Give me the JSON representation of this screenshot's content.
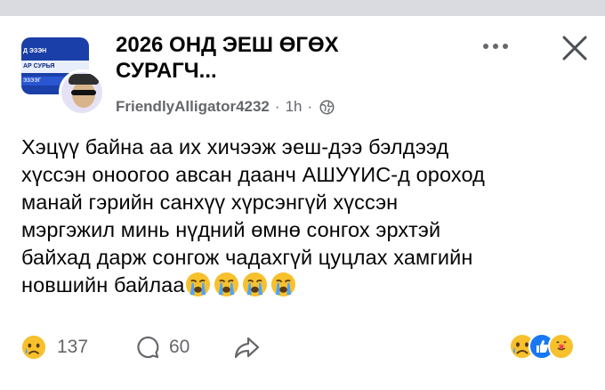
{
  "post": {
    "group_thumb_lines": [
      "Д ЭЗЭН",
      "АР СУРЬЯ",
      "ЭЗЭЭГ"
    ],
    "group_title_line1": "2026 ОНД ЭЕШ ӨГӨХ",
    "group_title_line2": "СУРАГЧ...",
    "author": "FriendlyAlligator4232",
    "separator": "·",
    "time": "1h",
    "privacy_icon": "globe-icon",
    "text_lines": [
      "Хэцүү байна аа их хичээж эеш-дээ бэлдээд",
      "хүссэн оноогоо авсан даанч АШУҮИС-д ороход",
      "манай гэрийн санхүү хүрсэнгүй хүссэн",
      "мэргэжил минь нүдний өмнө сонгох эрхтэй",
      "байхад дарж сонгож чадахгүй цуцлах хамгийн",
      "новшийн байлаа"
    ],
    "trailing_emojis": [
      "crying-face",
      "crying-face",
      "crying-face",
      "crying-face"
    ]
  },
  "footer": {
    "reaction_count": "137",
    "comment_count": "60",
    "reaction_icon": "sad-face-icon",
    "comment_icon": "comment-icon",
    "share_icon": "share-icon",
    "reaction_summary_icons": [
      "sad-face-icon",
      "like-icon",
      "care-icon"
    ]
  },
  "colors": {
    "text": "#050505",
    "meta": "#65676b",
    "top_strip": "#d9dbe0",
    "like_blue": "#1877f2",
    "emoji_yellow": "#f7c12e"
  }
}
